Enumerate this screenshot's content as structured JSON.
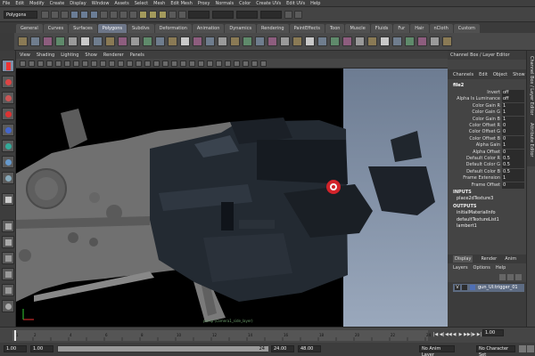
{
  "menu": [
    "File",
    "Edit",
    "Modify",
    "Create",
    "Display",
    "Window",
    "Assets",
    "Select",
    "Mesh",
    "Edit Mesh",
    "Proxy",
    "Normals",
    "Color",
    "Create UVs",
    "Edit UVs",
    "Help"
  ],
  "status": {
    "mode": "Polygons"
  },
  "shelf_tabs": [
    "General",
    "Curves",
    "Surfaces",
    "Polygons",
    "Subdivs",
    "Deformation",
    "Animation",
    "Dynamics",
    "Rendering",
    "PaintEffects",
    "Toon",
    "Muscle",
    "Fluids",
    "Fur",
    "Hair",
    "nCloth",
    "Custom"
  ],
  "viewport_menu": [
    "View",
    "Shading",
    "Lighting",
    "Show",
    "Renderer",
    "Panels"
  ],
  "viewport_camera_label": "persp (camera1_side_layer)",
  "channel_box": {
    "header": "Channel Box / Layer Editor",
    "tabs": [
      "Channels",
      "Edit",
      "Object",
      "Show"
    ],
    "node": "file2",
    "attributes": [
      {
        "label": "Invert",
        "value": "off"
      },
      {
        "label": "Alpha Is Luminance",
        "value": "off"
      },
      {
        "label": "Color Gain R",
        "value": "1"
      },
      {
        "label": "Color Gain G",
        "value": "1"
      },
      {
        "label": "Color Gain B",
        "value": "1"
      },
      {
        "label": "Color Offset R",
        "value": "0"
      },
      {
        "label": "Color Offset G",
        "value": "0"
      },
      {
        "label": "Color Offset B",
        "value": "0"
      },
      {
        "label": "Alpha Gain",
        "value": "1"
      },
      {
        "label": "Alpha Offset",
        "value": "0"
      },
      {
        "label": "Default Color R",
        "value": "0.5"
      },
      {
        "label": "Default Color G",
        "value": "0.5"
      },
      {
        "label": "Default Color B",
        "value": "0.5"
      },
      {
        "label": "Frame Extension",
        "value": "1"
      },
      {
        "label": "Frame Offset",
        "value": "0"
      }
    ],
    "inputs_label": "INPUTS",
    "inputs": [
      "place2dTexture3"
    ],
    "outputs_label": "OUTPUTS",
    "outputs": [
      "initialMaterialInfo",
      "defaultTextureList1",
      "lambert1"
    ]
  },
  "side_tabs": [
    "Channel Box / Layer Editor",
    "Attribute Editor"
  ],
  "layer_editor": {
    "tabs": [
      "Display",
      "Render",
      "Anim"
    ],
    "menu": [
      "Layers",
      "Options",
      "Help"
    ],
    "layer": {
      "visible": "V",
      "name": "gun_UI:trigger_01"
    }
  },
  "time": {
    "ticks": [
      "1",
      "2",
      "4",
      "6",
      "8",
      "10",
      "12",
      "14",
      "16",
      "18",
      "20",
      "22",
      "24"
    ],
    "current": "1.00",
    "range_start": "1.00",
    "range_start_inner": "1.00",
    "range_end_inner": "24",
    "range_end": "24.00",
    "anim_end": "48.00",
    "anim_layer": "No Anim Layer",
    "char_set": "No Character Set"
  },
  "colors": {
    "accent": "#6d7688",
    "viewport_left": "#000000",
    "viewport_right": "#8090a8"
  }
}
